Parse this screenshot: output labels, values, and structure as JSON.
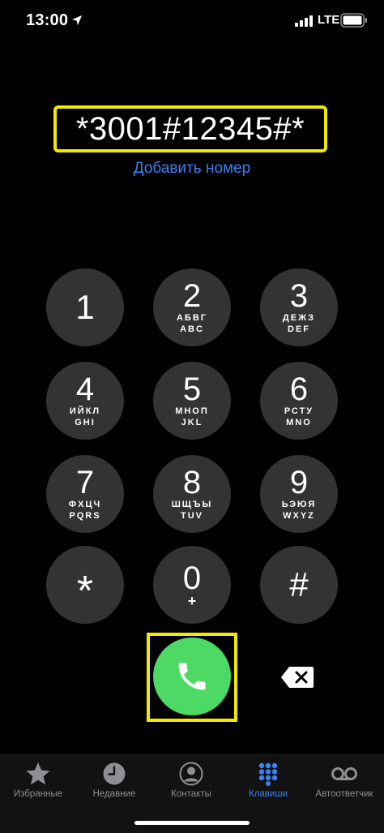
{
  "status_bar": {
    "time": "13:00",
    "network": "LTE"
  },
  "dialer": {
    "number": "*3001#12345#*",
    "add_number": "Добавить номер"
  },
  "keypad": {
    "keys": [
      {
        "digit": "1",
        "cyrillic": "",
        "latin": ""
      },
      {
        "digit": "2",
        "cyrillic": "АБВГ",
        "latin": "ABC"
      },
      {
        "digit": "3",
        "cyrillic": "ДЕЖЗ",
        "latin": "DEF"
      },
      {
        "digit": "4",
        "cyrillic": "ИЙКЛ",
        "latin": "GHI"
      },
      {
        "digit": "5",
        "cyrillic": "МНОП",
        "latin": "JKL"
      },
      {
        "digit": "6",
        "cyrillic": "РСТУ",
        "latin": "MNO"
      },
      {
        "digit": "7",
        "cyrillic": "ФХЦЧ",
        "latin": "PQRS"
      },
      {
        "digit": "8",
        "cyrillic": "ШЩЪЫ",
        "latin": "TUV"
      },
      {
        "digit": "9",
        "cyrillic": "ЬЭЮЯ",
        "latin": "WXYZ"
      },
      {
        "digit": "*",
        "cyrillic": "",
        "latin": ""
      },
      {
        "digit": "0",
        "cyrillic": "",
        "latin": "+"
      },
      {
        "digit": "#",
        "cyrillic": "",
        "latin": ""
      }
    ]
  },
  "tab_bar": {
    "tabs": [
      {
        "label": "Избранные",
        "icon": "star-icon",
        "active": false
      },
      {
        "label": "Недавние",
        "icon": "clock-icon",
        "active": false
      },
      {
        "label": "Контакты",
        "icon": "person-circle-icon",
        "active": false
      },
      {
        "label": "Клавиши",
        "icon": "keypad-icon",
        "active": true
      },
      {
        "label": "Автоответчик",
        "icon": "voicemail-icon",
        "active": false
      }
    ]
  },
  "colors": {
    "background": "#000000",
    "key": "#333333",
    "call": "#4cd964",
    "accent": "#3a82f7",
    "highlight": "#f2ea00",
    "tab_inactive": "#8e8e93"
  }
}
